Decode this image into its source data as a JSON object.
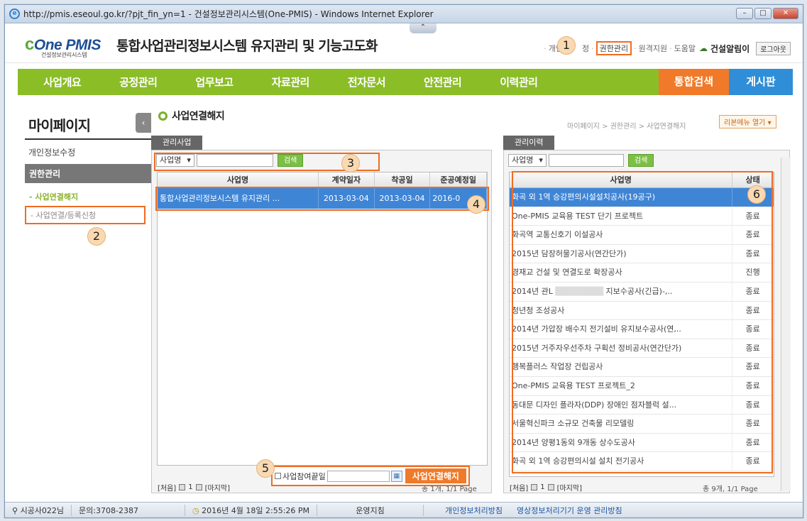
{
  "browser": {
    "url_title": "http://pmis.eseoul.go.kr/?pjt_fin_yn=1 - 건설정보관리시스템(One-PMIS) - Windows Internet Explorer"
  },
  "header": {
    "logo": "One PMIS",
    "logo_sub": "건설정보관리시스템",
    "system_title": "통합사업관리정보시스템 유지관리 및 기능고도화",
    "links": [
      "개인",
      "정",
      "권한관리",
      "원격지원",
      "도움말"
    ],
    "alarm": "건설알림이",
    "logout": "로그아웃"
  },
  "nav": {
    "items": [
      "사업개요",
      "공정관리",
      "업무보고",
      "자료관리",
      "전자문서",
      "안전관리",
      "이력관리"
    ],
    "search": "통합검색",
    "board": "게시판"
  },
  "sidebar": {
    "title": "마이페이지",
    "item1": "개인정보수정",
    "group": "권한관리",
    "sub_active": "- 사업연결해지",
    "sub2": "- 사업연결/등록신청"
  },
  "page": {
    "title": "사업연결해지",
    "breadcrumb": "마이페이지 > 권한관리 > 사업연결해지",
    "ribbon": "리본메뉴 열기"
  },
  "left_panel": {
    "tab": "관리사업",
    "select": "사업명",
    "search_btn": "검색",
    "columns": [
      "사업명",
      "계약일자",
      "착공일",
      "준공예정일"
    ],
    "rows": [
      [
        "통합사업관리정보시스템 유지관리 ...",
        "2013-03-04",
        "2013-03-04",
        "2016-0"
      ]
    ],
    "pager": {
      "first": "[처음]",
      "page": "1",
      "last": "[마지막]"
    },
    "total": "총 1개, 1/1 Page",
    "end_label": "사업참여끝일",
    "action_btn": "사업연결해지"
  },
  "right_panel": {
    "tab": "관리이력",
    "select": "사업명",
    "search_btn": "검색",
    "columns": [
      "사업명",
      "상태"
    ],
    "rows": [
      [
        "화곡 외 1역 승강편의시설설치공사(19공구)",
        ""
      ],
      [
        "One-PMIS 교육용 TEST 단기 프로젝트",
        "종료"
      ],
      [
        "화곡역 교통신호기 이설공사",
        "종료"
      ],
      [
        "2015년 담장허물기공사(연간단가)",
        "종료"
      ],
      [
        "경재교 건설 및 연결도로 확장공사",
        "진행"
      ],
      [
        "2014년 관L",
        "종료"
      ],
      [
        "청년청 조성공사",
        "종료"
      ],
      [
        "2014년 가압장 배수지 전기설비 유지보수공사(연,..",
        "종료"
      ],
      [
        "2015년 거주자우선주차 구획선 정비공사(연간단가)",
        "종료"
      ],
      [
        "행복플러스 작업장 건립공사",
        "종료"
      ],
      [
        "One-PMIS 교육용 TEST 프로젝트_2",
        "종료"
      ],
      [
        "동대문 디자인 플라자(DDP) 장애인 점자블럭 설...",
        "종료"
      ],
      [
        "서울혁신파크 소규모 건축물 리모델링",
        "종료"
      ],
      [
        "2014년 양평1동외 9개동 상수도공사",
        "종료"
      ],
      [
        "화곡 외 1역 승강편의시설 설치 전기공사",
        "종료"
      ]
    ],
    "row6_suffix": "지보수공사(긴급)-,..",
    "pager": {
      "first": "[처음]",
      "page": "1",
      "last": "[마지막]"
    },
    "total": "총 9개, 1/1 Page"
  },
  "callouts": [
    "1",
    "2",
    "3",
    "4",
    "5",
    "6"
  ],
  "statusbar": {
    "user": "시공사022님",
    "contact": "문의:3708-2387",
    "datetime": "2016년 4월 18일 2:55:26 PM",
    "policy": "운영지침",
    "privacy": "개인정보처리방침",
    "video": "영상정보처리기기 운영 관리방침"
  },
  "colors": {
    "nav_green": "#8bbd27",
    "accent_orange": "#f07a2a",
    "board_blue": "#2f8ed7",
    "select_blue": "#3f85d6"
  }
}
